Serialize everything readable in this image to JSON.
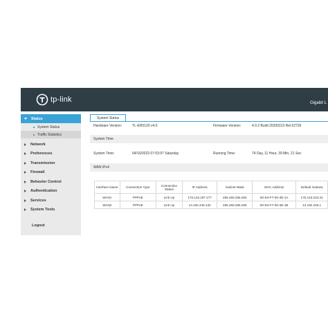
{
  "header": {
    "logo_text": "tp-link",
    "model_text": "Gigabit L"
  },
  "sidebar": {
    "items": [
      {
        "label": "Status"
      },
      {
        "label": "Network"
      },
      {
        "label": "Preferences"
      },
      {
        "label": "Transmission"
      },
      {
        "label": "Firewall"
      },
      {
        "label": "Behavior Control"
      },
      {
        "label": "Authentication"
      },
      {
        "label": "Services"
      },
      {
        "label": "System Tools"
      }
    ],
    "status_sub": [
      {
        "label": "System Status"
      },
      {
        "label": "Traffic Statistics"
      }
    ],
    "logout": "Logout"
  },
  "tab": {
    "label": "System Status"
  },
  "info": {
    "hardware_label": "Hardware Version:",
    "hardware_value": "TL-ER5120 v4.0",
    "firmware_label": "Firmware Version:",
    "firmware_value": "4.0.2 Build 20200313 Rel.52726",
    "system_time_section": "System Time",
    "system_time_label": "System Time:",
    "system_time_value": "04/15/2023 07:03:57 Saturday",
    "running_time_label": "Running Time:",
    "running_time_value": "74 Day, 11 Hour, 39 Min, 21 Sec",
    "wan_section": "WAN IPv4"
  },
  "wan_table": {
    "headers": [
      "Interface Name",
      "Connection Type",
      "Connection Status",
      "IP Address",
      "Subnet Mask",
      "MAC Address",
      "Default Gatewa"
    ],
    "rows": [
      [
        "WAN1",
        "PPPoE",
        "Link Up",
        "175.143.197.177",
        "255.255.255.255",
        "50-D4-F7-00-3D-1A",
        "175.143.223.24"
      ],
      [
        "WAN2",
        "PPPoE",
        "Link Up",
        "14.192.246.132",
        "255.255.255.255",
        "50-D4-F7-00-3D-1B",
        "14.192.246.1"
      ]
    ]
  },
  "colors": {
    "header_bg": "#2f3d45",
    "accent": "#3aa3d6",
    "sidebar_bg": "#eaeaea"
  }
}
